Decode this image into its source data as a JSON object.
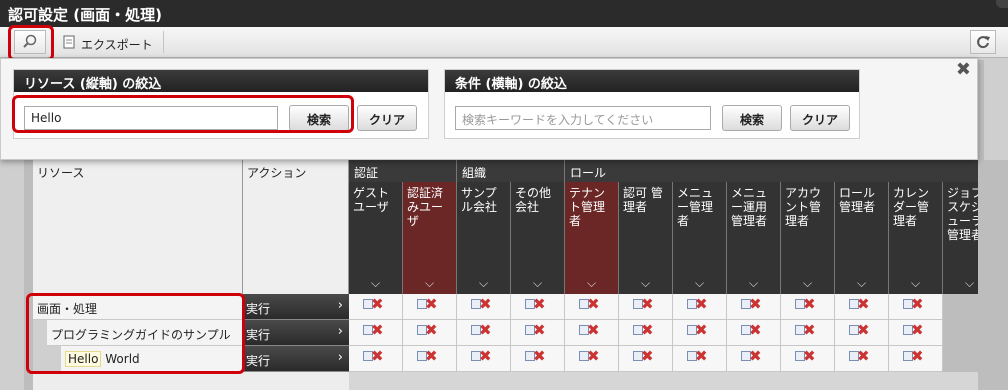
{
  "window": {
    "title": "認可設定 (画面・処理)"
  },
  "toolbar": {
    "search_icon": "magnifier-icon",
    "export_label": "エクスポート",
    "refresh_icon": "refresh-icon"
  },
  "popup": {
    "close_label": "✖",
    "resource_filter": {
      "title": "リソース (縦軸) の絞込",
      "value": "Hello",
      "search_label": "検索",
      "clear_label": "クリア"
    },
    "condition_filter": {
      "title": "条件 (横軸) の絞込",
      "placeholder": "検索キーワードを入力してください",
      "search_label": "検索",
      "clear_label": "クリア"
    }
  },
  "table": {
    "resource_header": "リソース",
    "action_header": "アクション",
    "groups": [
      "認証",
      "組織",
      "ロール"
    ],
    "roles": [
      "ゲスト\nユーザ",
      "認証済\nみユー\nザ",
      "サンプ\nル会社",
      "その他\n会社",
      "テナン\nト管理\n者",
      "認可 管\n理者",
      "メニュ\nー管理\n者",
      "メニュ\nー運用\n管理者",
      "アカウ\nント管\n理者",
      "ロール\n管理者",
      "カレン\nダー管\n理者",
      "ジョブ\nスケジ\nューラ\n管理者"
    ],
    "rows": [
      {
        "resource": "画面・処理",
        "action": "実行"
      },
      {
        "resource": "プログラミングガイドのサンプル",
        "action": "実行"
      },
      {
        "resource_hello": "Hello",
        "resource_rest": "World",
        "action": "実行"
      }
    ],
    "chevron": "⌵",
    "action_arrow": "›",
    "deny_mark": "✖"
  }
}
